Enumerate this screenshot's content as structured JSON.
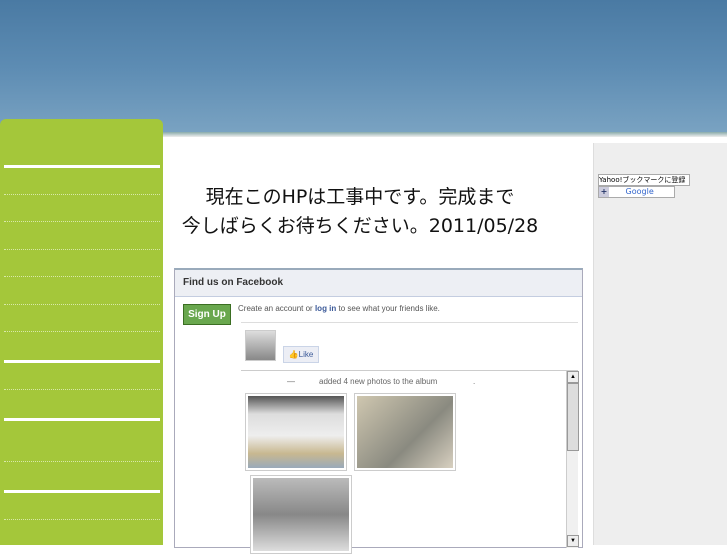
{
  "notice": {
    "line1": "現在このHPは工事中です。完成まで",
    "line2": "今しばらくお待ちください。2011/05/28"
  },
  "bookmarks": {
    "yahoo": "Yahoo!ブックマークに登録",
    "google": "Google",
    "google_plus": "+"
  },
  "facebook": {
    "title": "Find us on Facebook",
    "signup": "Sign Up",
    "create_pre": "Create an account or",
    "login": "log in",
    "create_post": "to see what your friends like.",
    "like": "Like",
    "activity_dash": "—",
    "activity": "added 4 new photos to the album",
    "activity_dot": "."
  }
}
